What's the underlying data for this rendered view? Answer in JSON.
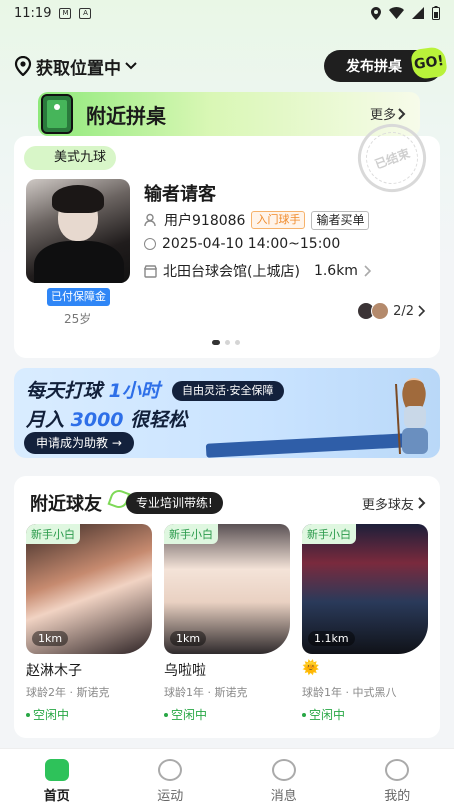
{
  "status": {
    "time": "11:19",
    "icon1": "notification-icon",
    "icon2": "app-icon"
  },
  "topbar": {
    "location_label": "获取位置中",
    "publish_label": "发布拼桌",
    "go_badge": "GO!"
  },
  "nearby": {
    "title": "附近拼桌",
    "more_label": "更多"
  },
  "game": {
    "category": "美式九球",
    "stamp": "已结束",
    "title": "输者请客",
    "user": "用户918086",
    "level_tag": "入门球手",
    "rule_tag": "输者买单",
    "time": "2025-04-10 14:00~15:00",
    "venue": "北田台球会馆(上城店)",
    "distance": "1.6km",
    "paid_badge": "已付保障金",
    "age": "25岁",
    "players": "2/2"
  },
  "promo": {
    "line1_a": "每天打球",
    "line1_hl": "1小时",
    "line2_a": "月入",
    "line2_hl": "3000",
    "line2_b": "很轻松",
    "pill": "自由灵活·安全保障",
    "apply": "申请成为助教 →"
  },
  "friends": {
    "title": "附近球友",
    "training_tag": "专业培训带练!",
    "more_label": "更多球友",
    "items": [
      {
        "badge": "新手小白",
        "distance": "1km",
        "name": "赵淋木子",
        "meta": "球龄2年 · 斯诺克",
        "status": "空闲中"
      },
      {
        "badge": "新手小白",
        "distance": "1km",
        "name": "乌啦啦",
        "meta": "球龄1年 · 斯诺克",
        "status": "空闲中"
      },
      {
        "badge": "新手小白",
        "distance": "1.1km",
        "name": "🌞",
        "meta": "球龄1年 · 中式黑八",
        "status": "空闲中"
      }
    ]
  },
  "tabs": [
    {
      "label": "首页"
    },
    {
      "label": "运动"
    },
    {
      "label": "消息"
    },
    {
      "label": "我的"
    }
  ],
  "colors": {
    "accent_green": "#2ec25a",
    "promo_blue": "#2e6fe8",
    "tag_orange": "#f08a2a"
  }
}
